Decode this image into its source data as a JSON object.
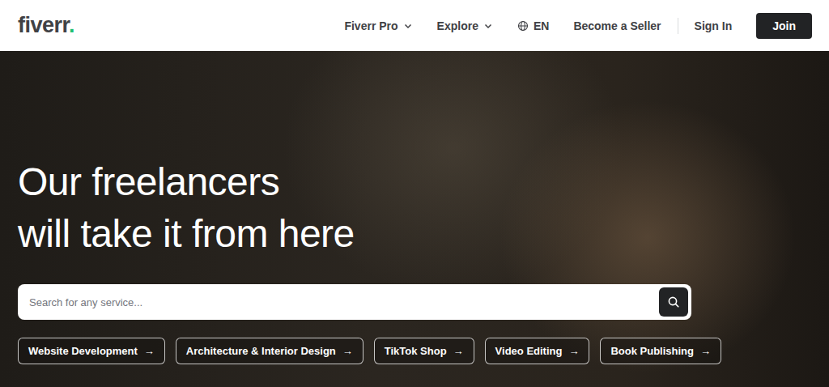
{
  "header": {
    "logo": {
      "text": "fiverr",
      "dot": "."
    },
    "nav": [
      {
        "label": "Fiverr Pro",
        "kind": "dropdown"
      },
      {
        "label": "Explore",
        "kind": "dropdown"
      },
      {
        "label": "EN",
        "kind": "language"
      },
      {
        "label": "Become a Seller",
        "kind": "link"
      }
    ],
    "sign_in": "Sign In",
    "join": "Join"
  },
  "hero": {
    "title_lines": [
      "Our freelancers",
      "will take it from here"
    ],
    "search": {
      "placeholder": "Search for any service..."
    },
    "categories": [
      {
        "label": "Website Development",
        "arrow": "→"
      },
      {
        "label": "Architecture & Interior Design",
        "arrow": "→"
      },
      {
        "label": "TikTok Shop",
        "arrow": "→"
      },
      {
        "label": "Video Editing",
        "arrow": "→"
      },
      {
        "label": "Book Publishing",
        "arrow": "→"
      }
    ]
  }
}
